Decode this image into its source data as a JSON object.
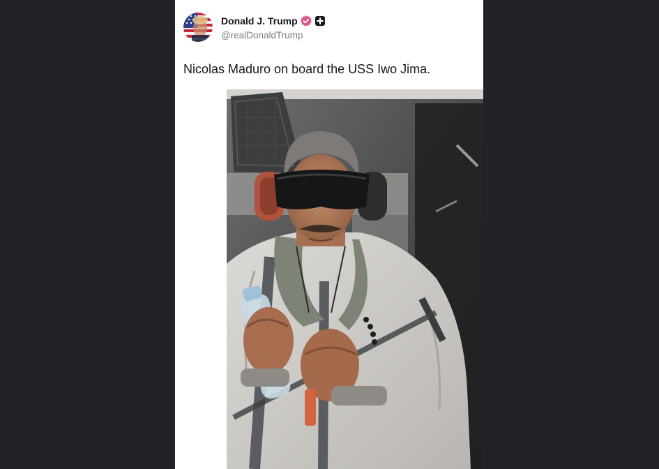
{
  "post": {
    "author": {
      "display_name": "Donald J. Trump",
      "handle": "@realDonaldTrump",
      "avatar_icon": "flag-portrait-avatar",
      "verified_icon": "verified-badge-icon",
      "verified_color": "#e0578c",
      "extra_badge_icon": "plus-badge-icon"
    },
    "text": "Nicolas Maduro on board the USS Iwo Jima.",
    "media": {
      "type": "photo"
    }
  },
  "theme": {
    "page_background": "#202226",
    "card_background": "#ffffff",
    "text_color": "#17181b",
    "muted_text_color": "#7a7d83"
  }
}
